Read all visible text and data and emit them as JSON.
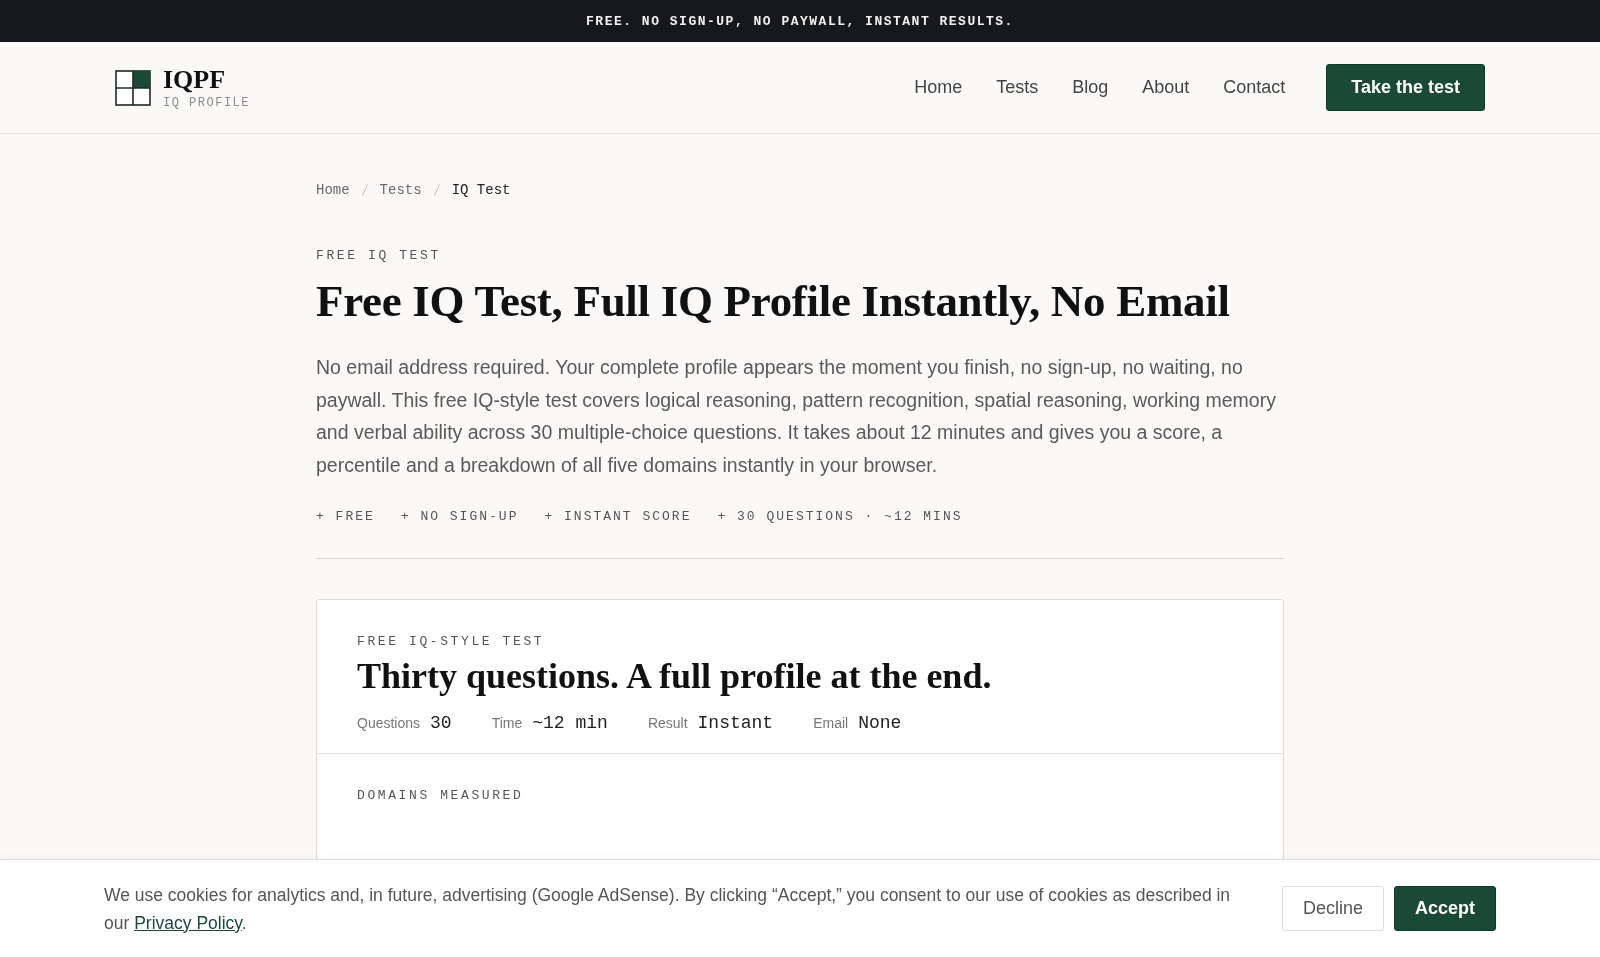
{
  "banner": "FREE. NO SIGN-UP, NO PAYWALL, INSTANT RESULTS.",
  "header": {
    "logo": {
      "name": "IQPF",
      "tagline": "IQ PROFILE"
    },
    "nav": [
      {
        "label": "Home"
      },
      {
        "label": "Tests"
      },
      {
        "label": "Blog"
      },
      {
        "label": "About"
      },
      {
        "label": "Contact"
      }
    ],
    "cta": "Take the test"
  },
  "breadcrumb": [
    {
      "label": "Home",
      "current": false
    },
    {
      "label": "Tests",
      "current": false
    },
    {
      "label": "IQ Test",
      "current": true
    }
  ],
  "hero": {
    "eyebrow": "FREE IQ TEST",
    "title": "Free IQ Test, Full IQ Profile Instantly, No Email",
    "intro": "No email address required. Your complete profile appears the moment you finish, no sign-up, no waiting, no paywall. This free IQ-style test covers logical reasoning, pattern recognition, spatial reasoning, working memory and verbal ability across 30 multiple-choice questions. It takes about 12 minutes and gives you a score, a percentile and a breakdown of all five domains instantly in your browser.",
    "features": [
      "+ FREE",
      "+ NO SIGN-UP",
      "+ INSTANT SCORE",
      "+ 30 QUESTIONS · ~12 MINS"
    ]
  },
  "card": {
    "eyebrow": "FREE IQ-STYLE TEST",
    "title": "Thirty questions. A full profile at the end.",
    "facts": [
      {
        "label": "Questions",
        "value": "30"
      },
      {
        "label": "Time",
        "value": "~12 min"
      },
      {
        "label": "Result",
        "value": "Instant"
      },
      {
        "label": "Email",
        "value": "None"
      }
    ],
    "section_label": "DOMAINS MEASURED"
  },
  "cookie": {
    "text": "We use cookies for analytics and, in future, advertising (Google AdSense). By clicking “Accept,” you consent to our use of cookies as described in our",
    "link": "Privacy Policy",
    "end": ".",
    "buttons": [
      {
        "label": "Decline",
        "kind": "secondary"
      },
      {
        "label": "Accept",
        "kind": "primary"
      }
    ]
  }
}
